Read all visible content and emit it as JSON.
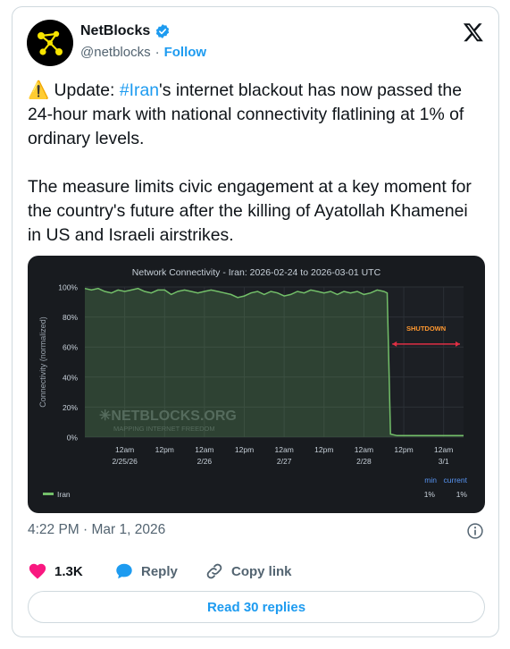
{
  "author": {
    "name": "NetBlocks",
    "handle": "@netblocks",
    "separator": "·",
    "follow_label": "Follow"
  },
  "tweet": {
    "p1_prefix": "⚠️ Update: ",
    "p1_hashtag": "#Iran",
    "p1_rest": "'s internet blackout has now passed the 24-hour mark with national connectivity flatlining at 1% of ordinary levels.",
    "p2": "The measure limits civic engagement at a key moment for the country's future after the killing of Ayatollah Khamenei in US and Israeli airstrikes."
  },
  "chart_data": {
    "type": "area",
    "title": "Network Connectivity - Iran: 2026-02-24 to 2026-03-01 UTC",
    "ylabel": "Connectivity (normalized)",
    "ylim": [
      0,
      100
    ],
    "y_ticks": [
      "0%",
      "20%",
      "40%",
      "60%",
      "80%",
      "100%"
    ],
    "x_ticks": [
      {
        "line1": "12am",
        "line2": "2/25/26"
      },
      {
        "line1": "12pm",
        "line2": ""
      },
      {
        "line1": "12am",
        "line2": "2/26"
      },
      {
        "line1": "12pm",
        "line2": ""
      },
      {
        "line1": "12am",
        "line2": "2/27"
      },
      {
        "line1": "12pm",
        "line2": ""
      },
      {
        "line1": "12am",
        "line2": "2/28"
      },
      {
        "line1": "12pm",
        "line2": ""
      },
      {
        "line1": "12am",
        "line2": "3/1"
      }
    ],
    "x_hours_start": 0,
    "x_hours_end": 114,
    "series": [
      {
        "name": "Iran",
        "color": "#73bf69",
        "x_hours": [
          0,
          2,
          4,
          6,
          8,
          10,
          12,
          14,
          16,
          18,
          20,
          22,
          24,
          26,
          28,
          30,
          32,
          34,
          36,
          38,
          40,
          42,
          44,
          46,
          48,
          50,
          52,
          54,
          56,
          58,
          60,
          62,
          64,
          66,
          68,
          70,
          72,
          74,
          76,
          78,
          80,
          82,
          84,
          86,
          88,
          90,
          91,
          92,
          94,
          96,
          98,
          100,
          102,
          104,
          106,
          108,
          110,
          112,
          114
        ],
        "values": [
          99,
          98,
          99,
          97,
          96,
          98,
          97,
          98,
          99,
          97,
          96,
          98,
          98,
          95,
          97,
          98,
          97,
          96,
          97,
          98,
          97,
          96,
          95,
          93,
          94,
          96,
          97,
          95,
          97,
          96,
          94,
          95,
          97,
          96,
          98,
          97,
          96,
          97,
          95,
          97,
          96,
          97,
          95,
          96,
          98,
          97,
          96,
          2,
          1,
          1,
          1,
          1,
          1,
          1,
          1,
          1,
          1,
          1,
          1
        ],
        "min": "1%",
        "current": "1%"
      }
    ],
    "annotation": "SHUTDOWN",
    "legend_min_label": "min",
    "legend_current_label": "current",
    "watermark_main": "NETBLOCKS",
    "watermark_suffix": ".ORG",
    "watermark_tagline": "MAPPING INTERNET FREEDOM"
  },
  "timestamp": "4:22 PM · Mar 1, 2026",
  "actions": {
    "likes": "1.3K",
    "reply_label": "Reply",
    "copy_label": "Copy link"
  },
  "read_replies": "Read 30 replies"
}
